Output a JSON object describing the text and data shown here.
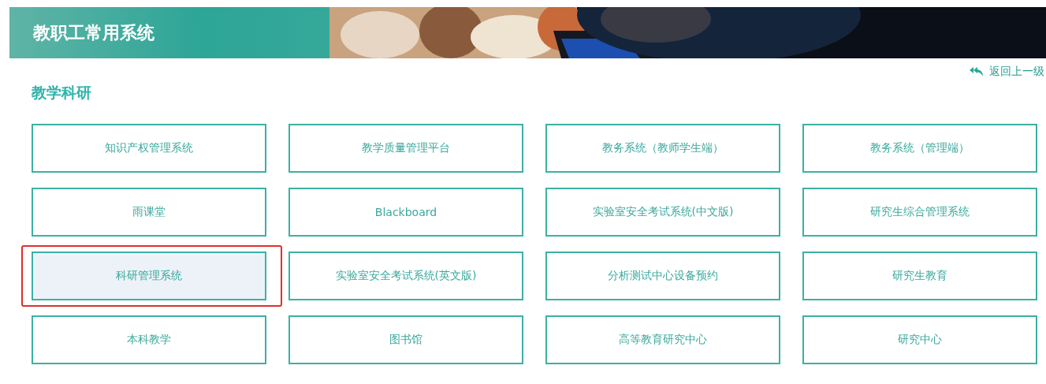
{
  "banner": {
    "title": "教职工常用系统"
  },
  "back_link": {
    "label": "返回上一级"
  },
  "section": {
    "title": "教学科研"
  },
  "tiles": [
    {
      "label": "知识产权管理系统",
      "highlighted": false
    },
    {
      "label": "教学质量管理平台",
      "highlighted": false
    },
    {
      "label": "教务系统（教师学生端）",
      "highlighted": false
    },
    {
      "label": "教务系统（管理端）",
      "highlighted": false
    },
    {
      "label": "雨课堂",
      "highlighted": false
    },
    {
      "label": "Blackboard",
      "highlighted": false
    },
    {
      "label": "实验室安全考试系统(中文版)",
      "highlighted": false
    },
    {
      "label": "研究生综合管理系统",
      "highlighted": false
    },
    {
      "label": "科研管理系统",
      "highlighted": true
    },
    {
      "label": "实验室安全考试系统(英文版)",
      "highlighted": false
    },
    {
      "label": "分析测试中心设备预约",
      "highlighted": false
    },
    {
      "label": "研究生教育",
      "highlighted": false
    },
    {
      "label": "本科教学",
      "highlighted": false
    },
    {
      "label": "图书馆",
      "highlighted": false
    },
    {
      "label": "高等教育研究中心",
      "highlighted": false
    },
    {
      "label": "研究中心",
      "highlighted": false
    }
  ]
}
